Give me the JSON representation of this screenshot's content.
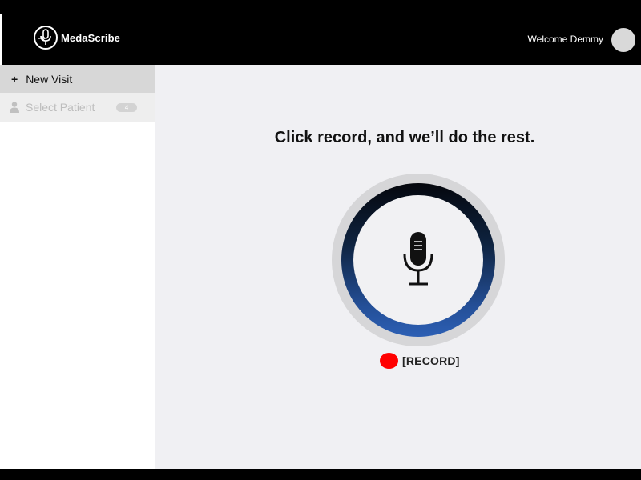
{
  "header": {
    "app_name": "MedaScribe",
    "welcome_text": "Welcome Demmy"
  },
  "sidebar": {
    "items": [
      {
        "label": "New Visit",
        "icon": "plus-icon"
      },
      {
        "label": "Select Patient",
        "icon": "person-icon",
        "badge": "4"
      }
    ]
  },
  "main": {
    "headline": "Click record, and we’ll do the rest.",
    "record_button_icon": "microphone-icon",
    "record_label": "[RECORD]"
  },
  "colors": {
    "header_bg": "#000000",
    "sidebar_active_bg": "#d7d7d7",
    "main_bg": "#f0f0f3",
    "ring_blue": "#2c5fb4",
    "record_dot": "#ff0000"
  }
}
